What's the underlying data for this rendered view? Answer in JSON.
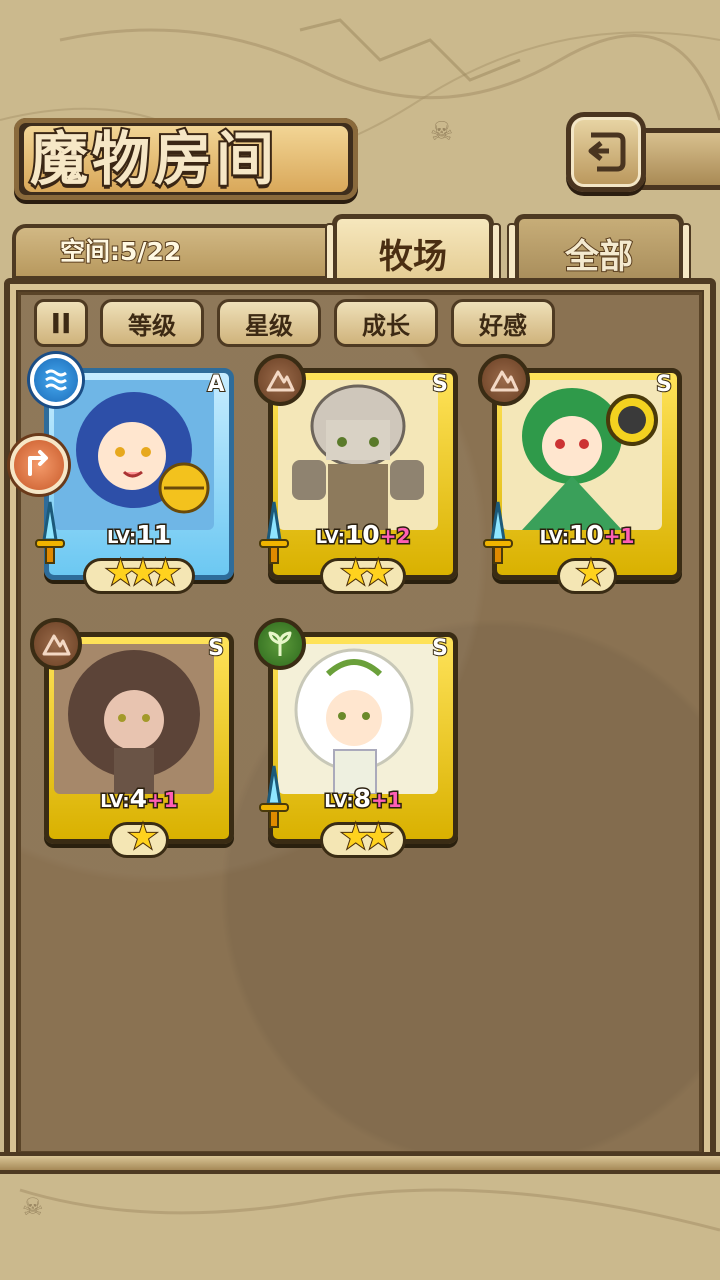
{
  "header": {
    "title": "魔物房间"
  },
  "info": {
    "space": "空间:5/22"
  },
  "tabs": [
    {
      "label": "牧场",
      "active": true
    },
    {
      "label": "全部",
      "active": false
    }
  ],
  "sort": {
    "toggle": "II",
    "buttons": [
      "等级",
      "星级",
      "成长",
      "好感"
    ]
  },
  "monsters": [
    {
      "rank": "A",
      "element": "water",
      "lv": "11",
      "plus": "",
      "stars": "★★★",
      "frame": "blue",
      "portrait": "blue-haired girl with bell"
    },
    {
      "rank": "S",
      "element": "earth",
      "lv": "10",
      "plus": "+2",
      "stars": "★★",
      "frame": "gold",
      "portrait": "stone golem"
    },
    {
      "rank": "S",
      "element": "earth",
      "lv": "10",
      "plus": "+1",
      "stars": "★",
      "frame": "gold",
      "portrait": "green-haired girl"
    },
    {
      "rank": "S",
      "element": "earth",
      "lv": "4",
      "plus": "+1",
      "stars": "★",
      "frame": "gold",
      "portrait": "brown-haired girl"
    },
    {
      "rank": "S",
      "element": "grass",
      "lv": "8",
      "plus": "+1",
      "stars": "★★",
      "frame": "gold",
      "portrait": "white-haired girl"
    }
  ],
  "level_prefix": "LV:",
  "colors": {
    "panel": "#8a7252",
    "gold_frame": "#ffe35a",
    "blue_frame": "#6cc8f2",
    "plus": "#ff5fb4",
    "star": "#ffd21e"
  },
  "icons": {
    "back": "back-arrow-icon",
    "water": "water-element-icon",
    "earth": "earth-element-icon",
    "grass": "grass-element-icon",
    "weapon": "sword-icon",
    "side": "side-marker-icon"
  }
}
